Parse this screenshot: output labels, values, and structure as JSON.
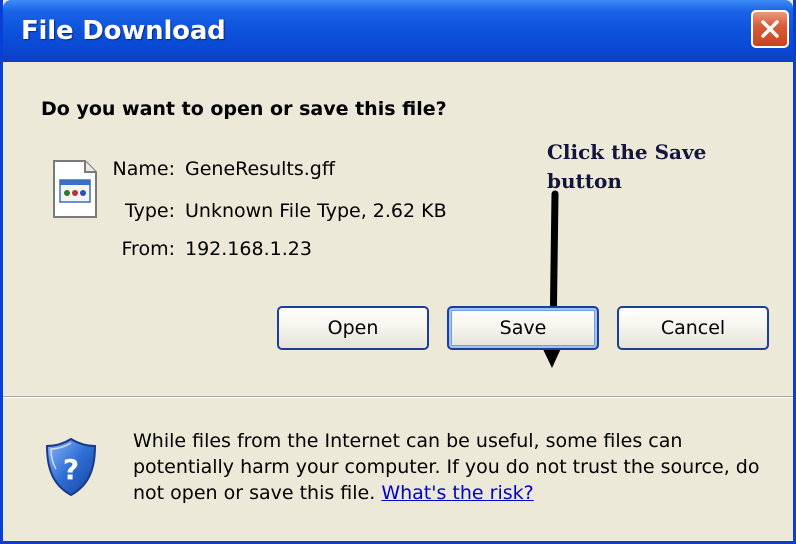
{
  "window": {
    "title": "File Download"
  },
  "dialog": {
    "question": "Do you want to open or save this file?",
    "file": {
      "name_label": "Name:",
      "name_value": "GeneResults.gff",
      "type_label": "Type:",
      "type_value": "Unknown File Type, 2.62 KB",
      "from_label": "From:",
      "from_value": "192.168.1.23"
    },
    "buttons": {
      "open": "Open",
      "save": "Save",
      "cancel": "Cancel"
    },
    "annotation": "Click the Save\nbutton",
    "warning": {
      "text": "While files from the Internet can be useful, some files can potentially harm your computer. If you do not trust the source, do not open or save this file. ",
      "link": "What's the risk?"
    }
  },
  "icons": {
    "close": "close-icon",
    "file": "unknown-file-icon",
    "shield": "security-shield-icon",
    "arrow": "arrow-down-icon"
  },
  "colors": {
    "titlebar": "#0a48d2",
    "close_button": "#d85d3a",
    "dialog_background": "#ece9d8",
    "button_border": "#1c3f94",
    "link": "#0000cc",
    "annotation": "#14143c"
  }
}
